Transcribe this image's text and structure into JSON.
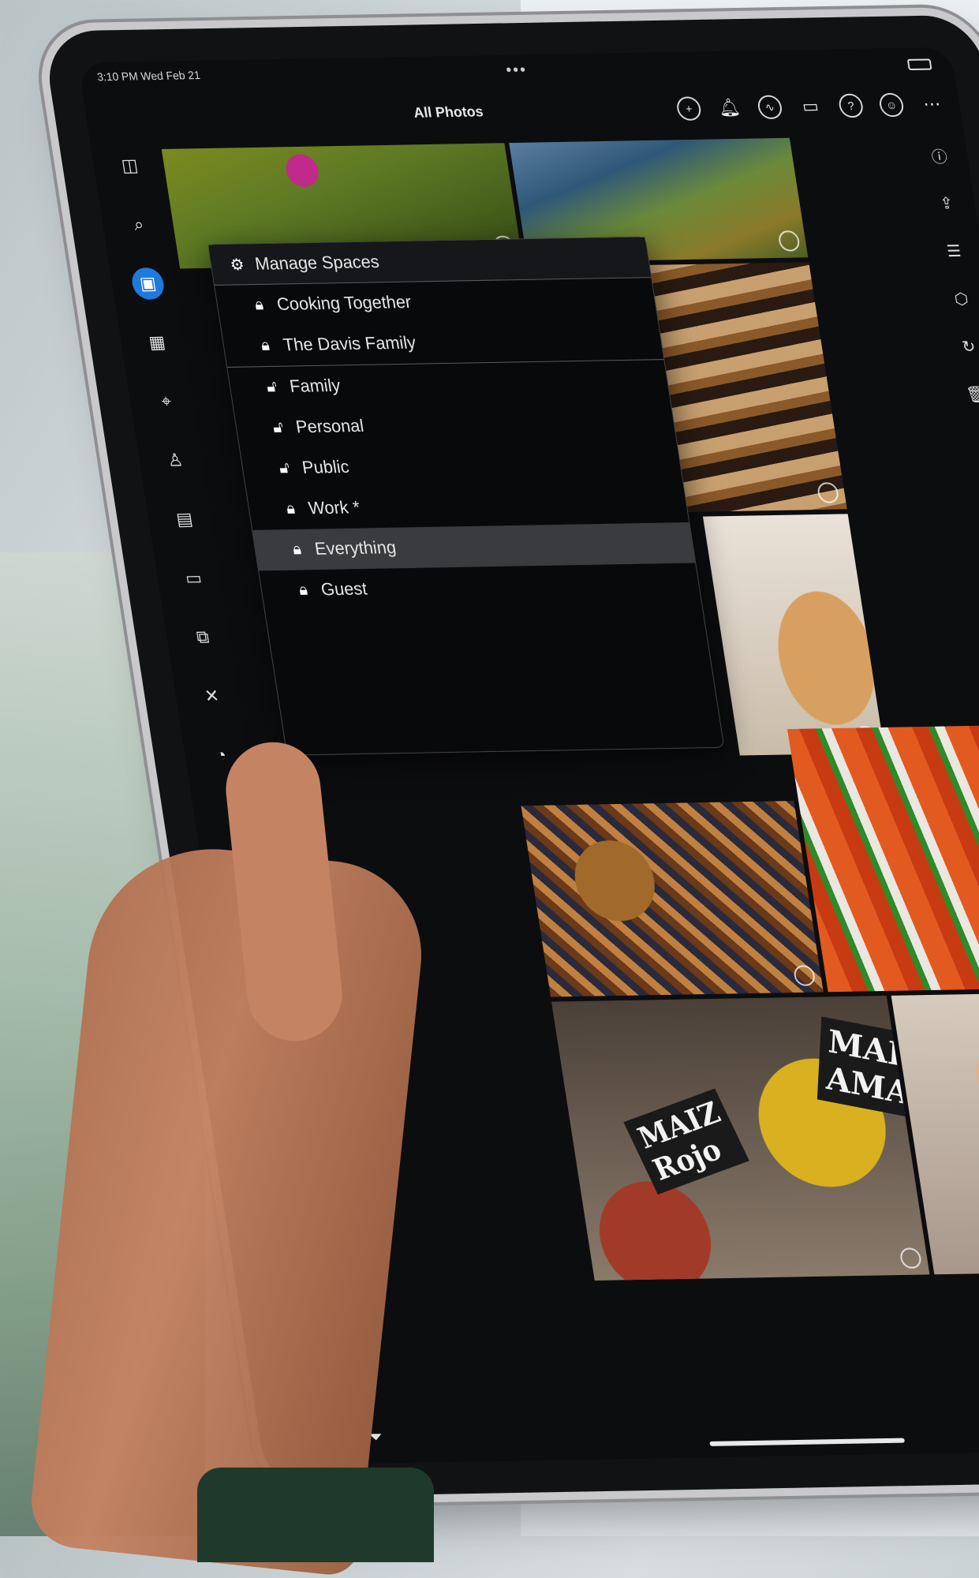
{
  "status_bar": {
    "time": "3:10 PM  Wed Feb 21",
    "multitask_dots": "•••"
  },
  "header": {
    "title": "All Photos",
    "icons": [
      "add-circle-icon",
      "notification-bell-icon",
      "activity-icon",
      "devices-icon",
      "help-icon",
      "account-icon",
      "more-icon"
    ]
  },
  "left_rail": [
    "sidebar-toggle-icon",
    "search-icon",
    "photos-icon",
    "calendar-icon",
    "location-icon",
    "people-icon",
    "albums-icon",
    "folder-icon",
    "duplicates-icon",
    "tools-icon",
    "dashboard-icon"
  ],
  "right_rail": [
    "info-icon",
    "share-icon",
    "adjust-icon",
    "tag-icon",
    "rotate-icon",
    "trash-icon"
  ],
  "spaces_menu": {
    "manage_label": "Manage Spaces",
    "items": [
      {
        "label": "Cooking Together",
        "locked": true,
        "group": 1
      },
      {
        "label": "The Davis Family",
        "locked": true,
        "group": 1
      },
      {
        "label": "Family",
        "locked": false,
        "group": 2
      },
      {
        "label": "Personal",
        "locked": false,
        "group": 2
      },
      {
        "label": "Public",
        "locked": false,
        "group": 2
      },
      {
        "label": "Work *",
        "locked": true,
        "group": 2
      },
      {
        "label": "Everything",
        "locked": true,
        "group": 2,
        "selected": true
      },
      {
        "label": "Guest",
        "locked": true,
        "group": 2
      }
    ]
  },
  "photos": {
    "signs": [
      "MAIZ AMARILLO",
      "MAIZ Rojo"
    ]
  },
  "colors": {
    "accent": "#1f7ae0",
    "panel_bg": "#08090b",
    "selected_row": "#3a3b3e"
  }
}
